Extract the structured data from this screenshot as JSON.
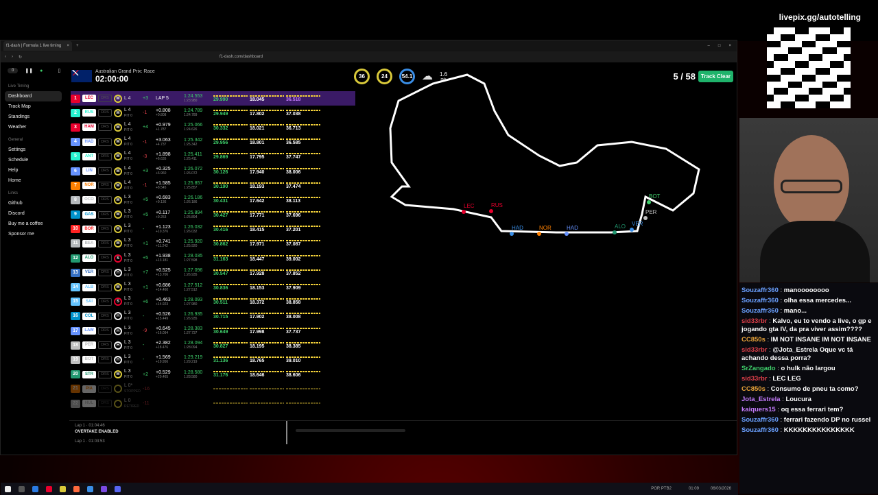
{
  "browser": {
    "tab_title": "f1-dash | Formula 1 live timing",
    "url": "f1-dash.com/dashboard"
  },
  "sidebar": {
    "counter": "0",
    "sections": [
      {
        "title": "Live Timing",
        "items": [
          "Dashboard",
          "Track Map",
          "Standings",
          "Weather"
        ]
      },
      {
        "title": "General",
        "items": [
          "Settings",
          "Schedule",
          "Help",
          "Home"
        ]
      },
      {
        "title": "Links",
        "items": [
          "Github",
          "Discord",
          "Buy me a coffee",
          "Sponsor me"
        ]
      }
    ]
  },
  "header": {
    "race": "Australian Grand Prix: Race",
    "time": "02:00:00",
    "gauges": [
      {
        "v": "36",
        "l": "TRC"
      },
      {
        "v": "24",
        "l": "AIR"
      },
      {
        "v": "54.1",
        "l": "%"
      }
    ],
    "wind": "1.6",
    "wind_unit": "m/s",
    "lap": "5 / 58",
    "status": "Track Clear"
  },
  "drivers": [
    {
      "pos": "1",
      "code": "LEC",
      "color": "#e8002d",
      "tyre": "M",
      "lap": "L 4",
      "pit": "",
      "chg": "+3",
      "gap": "LAP 5",
      "int": "",
      "best": "1:24.553",
      "prev": "1:23.980",
      "s1": "29.990",
      "s2": "18.045",
      "s3": "36.518"
    },
    {
      "pos": "2",
      "code": "RUS",
      "color": "#27f4d2",
      "tyre": "M",
      "lap": "L 4",
      "pit": "PIT 0",
      "chg": "-1",
      "gap": "+0.808",
      "int": "+0.808",
      "best": "1:24.789",
      "prev": "1:24.789",
      "s1": "29.949",
      "s2": "17.802",
      "s3": "37.038"
    },
    {
      "pos": "3",
      "code": "HAM",
      "color": "#e8002d",
      "tyre": "M",
      "lap": "L 4",
      "pit": "PIT 0",
      "chg": "+4",
      "gap": "+0.979",
      "int": "+1.787",
      "best": "1:25.066",
      "prev": "1:24.626",
      "s1": "30.332",
      "s2": "18.021",
      "s3": "36.713"
    },
    {
      "pos": "4",
      "code": "HAD",
      "color": "#6692ff",
      "tyre": "M",
      "lap": "L 4",
      "pit": "PIT 0",
      "chg": "-1",
      "gap": "+3.063",
      "int": "+4.737",
      "best": "1:25.342",
      "prev": "1:25.342",
      "s1": "29.956",
      "s2": "18.801",
      "s3": "36.585"
    },
    {
      "pos": "5",
      "code": "ANT",
      "color": "#27f4d2",
      "tyre": "M",
      "lap": "L 4",
      "pit": "PIT 0",
      "chg": "-3",
      "gap": "+1.898",
      "int": "+6.635",
      "best": "1:25.411",
      "prev": "1:25.411",
      "s1": "29.869",
      "s2": "17.795",
      "s3": "37.747"
    },
    {
      "pos": "6",
      "code": "LIN",
      "color": "#6692ff",
      "tyre": "M",
      "lap": "L 4",
      "pit": "PIT 0",
      "chg": "+3",
      "gap": "+0.325",
      "int": "+6.960",
      "best": "1:26.072",
      "prev": "1:26.072",
      "s1": "30.126",
      "s2": "17.940",
      "s3": "38.006"
    },
    {
      "pos": "7",
      "code": "NOR",
      "color": "#ff8000",
      "tyre": "M",
      "lap": "L 4",
      "pit": "PIT 0",
      "chg": "-1",
      "gap": "+1.585",
      "int": "+8.545",
      "best": "1:25.857",
      "prev": "1:25.857",
      "s1": "30.190",
      "s2": "18.193",
      "s3": "37.474"
    },
    {
      "pos": "8",
      "code": "OCO",
      "color": "#b6babd",
      "tyre": "M",
      "lap": "L 3",
      "pit": "PIT 0",
      "chg": "+5",
      "gap": "+0.683",
      "int": "+9.136",
      "best": "1:26.186",
      "prev": "1:26.186",
      "s1": "30.431",
      "s2": "17.642",
      "s3": "38.113"
    },
    {
      "pos": "9",
      "code": "GAS",
      "color": "#0093cc",
      "tyre": "M",
      "lap": "L 3",
      "pit": "PIT 0",
      "chg": "+5",
      "gap": "+0.117",
      "int": "+9.253",
      "best": "1:25.894",
      "prev": "1:25.894",
      "s1": "30.427",
      "s2": "17.771",
      "s3": "37.696"
    },
    {
      "pos": "10",
      "code": "BOR",
      "color": "#ff2222",
      "tyre": "M",
      "lap": "L 3",
      "pit": "PIT 0",
      "chg": "-",
      "gap": "+1.123",
      "int": "+10.376",
      "best": "1:26.032",
      "prev": "1:26.032",
      "s1": "30.416",
      "s2": "18.415",
      "s3": "37.201"
    },
    {
      "pos": "11",
      "code": "BEA",
      "color": "#b6babd",
      "tyre": "M",
      "lap": "L 3",
      "pit": "PIT 0",
      "chg": "+1",
      "gap": "+0.741",
      "int": "+11.242",
      "best": "1:25.920",
      "prev": "1:25.920",
      "s1": "30.862",
      "s2": "17.971",
      "s3": "37.087"
    },
    {
      "pos": "12",
      "code": "ALO",
      "color": "#229971",
      "tyre": "S",
      "lap": "L 3",
      "pit": "PIT 0",
      "chg": "+5",
      "gap": "+1.938",
      "int": "+13.181",
      "best": "1:28.035",
      "prev": "1:27.598",
      "s1": "31.163",
      "s2": "18.447",
      "s3": "39.002"
    },
    {
      "pos": "13",
      "code": "VER",
      "color": "#3671c6",
      "tyre": "H",
      "lap": "L 3",
      "pit": "PIT 0",
      "chg": "+7",
      "gap": "+0.525",
      "int": "+13.706",
      "best": "1:27.096",
      "prev": "1:26.935",
      "s1": "30.547",
      "s2": "17.928",
      "s3": "37.852"
    },
    {
      "pos": "14",
      "code": "ALB",
      "color": "#64c4ff",
      "tyre": "M",
      "lap": "L 3",
      "pit": "PIT 0",
      "chg": "+1",
      "gap": "+0.686",
      "int": "+14.460",
      "best": "1:27.512",
      "prev": "1:27.512",
      "s1": "30.836",
      "s2": "18.153",
      "s3": "37.909"
    },
    {
      "pos": "15",
      "code": "SAI",
      "color": "#64c4ff",
      "tyre": "S",
      "lap": "L 3",
      "pit": "PIT 0",
      "chg": "+6",
      "gap": "+0.463",
      "int": "+14.923",
      "best": "1:28.093",
      "prev": "1:27.980",
      "s1": "30.511",
      "s2": "18.372",
      "s3": "38.858"
    },
    {
      "pos": "16",
      "code": "COL",
      "color": "#0093cc",
      "tyre": "H",
      "lap": "L 3",
      "pit": "PIT 0",
      "chg": "-",
      "gap": "+0.526",
      "int": "+15.449",
      "best": "1:26.935",
      "prev": "1:26.935",
      "s1": "30.715",
      "s2": "17.902",
      "s3": "38.008"
    },
    {
      "pos": "17",
      "code": "LAW",
      "color": "#6692ff",
      "tyre": "H",
      "lap": "L 3",
      "pit": "PIT 0",
      "chg": "-9",
      "gap": "+0.645",
      "int": "+16.094",
      "best": "1:28.383",
      "prev": "1:27.737",
      "s1": "30.649",
      "s2": "17.998",
      "s3": "37.737"
    },
    {
      "pos": "18",
      "code": "PER",
      "color": "#c0c0c0",
      "tyre": "H",
      "lap": "L 3",
      "pit": "PIT 0",
      "chg": "-",
      "gap": "+2.382",
      "int": "+18.476",
      "best": "1:28.094",
      "prev": "1:28.094",
      "s1": "30.827",
      "s2": "18.195",
      "s3": "38.385"
    },
    {
      "pos": "19",
      "code": "BOT",
      "color": "#c0c0c0",
      "tyre": "H",
      "lap": "L 3",
      "pit": "PIT 0",
      "chg": "-",
      "gap": "+1.569",
      "int": "+19.956",
      "best": "1:29.219",
      "prev": "1:29.219",
      "s1": "31.136",
      "s2": "18.765",
      "s3": "39.010"
    },
    {
      "pos": "20",
      "code": "STR",
      "color": "#229971",
      "tyre": "M",
      "lap": "L 3",
      "pit": "PIT 0",
      "chg": "+2",
      "gap": "+0.529",
      "int": "+20.465",
      "best": "1:28.580",
      "prev": "1:28.580",
      "s1": "31.176",
      "s2": "18.646",
      "s3": "38.606"
    },
    {
      "pos": "21",
      "code": "PIA",
      "color": "#ff8000",
      "tyre": "",
      "lap": "L 0*",
      "pit": "STOPPED",
      "chg": "-16",
      "gap": "",
      "int": "",
      "best": "",
      "prev": "",
      "s1": "",
      "s2": "",
      "s3": "",
      "out": true
    },
    {
      "pos": "22",
      "code": "HUL",
      "color": "#c0c0c0",
      "tyre": "",
      "lap": "L 0",
      "pit": "RETIRED",
      "chg": "-11",
      "gap": "",
      "int": "",
      "best": "",
      "prev": "",
      "s1": "",
      "s2": "",
      "s3": "",
      "out": true
    }
  ],
  "race_control": {
    "line1": "Lap 1 · 01:04:46",
    "msg": "OVERTAKE ENABLED",
    "line2": "Lap 1 · 01:03:53"
  },
  "track_labels": [
    "LEC",
    "RUS",
    "HAD",
    "NOR",
    "HAD",
    "ALO",
    "VER",
    "PER",
    "BOT"
  ],
  "stream": {
    "livepix": "livepix.gg/autotelling"
  },
  "chat": [
    {
      "u": "Souzaffr360",
      "c": "#6aa0ff",
      "m": "manoooooooo"
    },
    {
      "u": "Souzaffr360",
      "c": "#6aa0ff",
      "m": "olha essa mercedes..."
    },
    {
      "u": "Souzaffr360",
      "c": "#6aa0ff",
      "m": "mano..."
    },
    {
      "u": "sid33rbr",
      "c": "#e0404a",
      "m": "Kalvo, eu to vendo a live, o gp e jogando gta IV, da pra viver assim????"
    },
    {
      "u": "CC850s",
      "c": "#e8a33a",
      "m": "IM NOT INSANE IM NOT INSANE"
    },
    {
      "u": "sid33rbr",
      "c": "#e0404a",
      "m": "@Jota_Estrela Oque vc tá achando dessa porra?"
    },
    {
      "u": "SrZangado",
      "c": "#3fcf6b",
      "m": "o hulk não largou"
    },
    {
      "u": "sid33rbr",
      "c": "#e0404a",
      "m": "LEC LEG"
    },
    {
      "u": "CC850s",
      "c": "#e8a33a",
      "m": "Consumo de pneu ta como?"
    },
    {
      "u": "Jota_Estrela",
      "c": "#c77dff",
      "m": "Loucura"
    },
    {
      "u": "kaiquers15",
      "c": "#c77dff",
      "m": "oq essa ferrari tem?"
    },
    {
      "u": "Souzaffr360",
      "c": "#6aa0ff",
      "m": "ferrari fazendo DP no russel"
    },
    {
      "u": "Souzaffr360",
      "c": "#6aa0ff",
      "m": "KKKKKKKKKKKKKKK"
    }
  ],
  "taskbar": {
    "clock": "01:09",
    "date": "06/03/2026",
    "lang": "POR PTB2"
  }
}
